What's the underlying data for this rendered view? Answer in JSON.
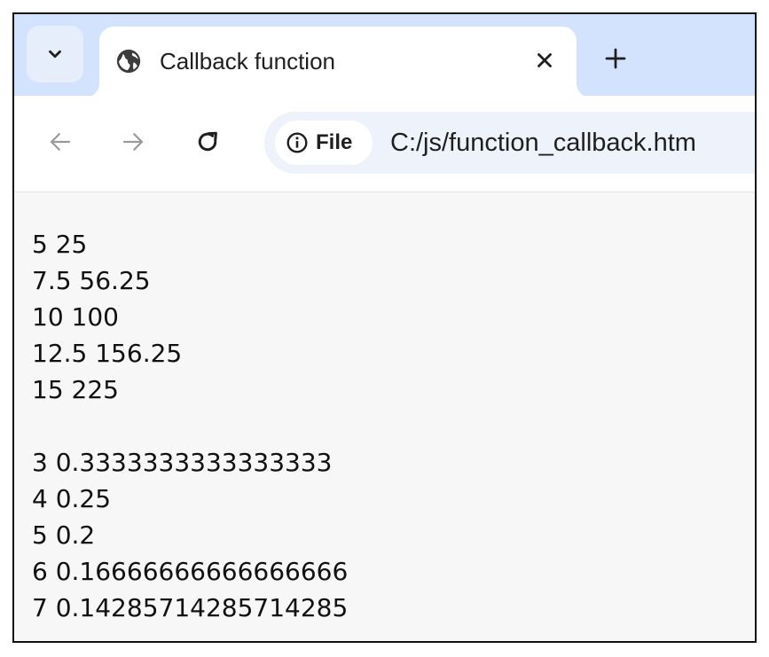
{
  "browser": {
    "tab": {
      "title": "Callback function",
      "favicon": "globe-icon",
      "close_symbol": "✕"
    },
    "new_tab_symbol": "+",
    "tab_search_icon": "chevron-down-icon",
    "nav": {
      "back_icon": "arrow-left-icon",
      "forward_icon": "arrow-right-icon",
      "reload_icon": "reload-icon"
    },
    "address": {
      "chip_icon": "info-icon",
      "chip_label": "File",
      "url": "C:/js/function_callback.htm"
    }
  },
  "output": {
    "block1": [
      "5 25",
      "7.5 56.25",
      "10 100",
      "12.5 156.25",
      "15 225"
    ],
    "block2": [
      "3 0.3333333333333333",
      "4 0.25",
      "5 0.2",
      "6 0.16666666666666666",
      "7 0.14285714285714285"
    ]
  },
  "colors": {
    "tabstrip": "#d3e3fd",
    "omnibox": "#eef2fa",
    "page_background": "#f7f7f7",
    "text": "#1f1f1f"
  }
}
